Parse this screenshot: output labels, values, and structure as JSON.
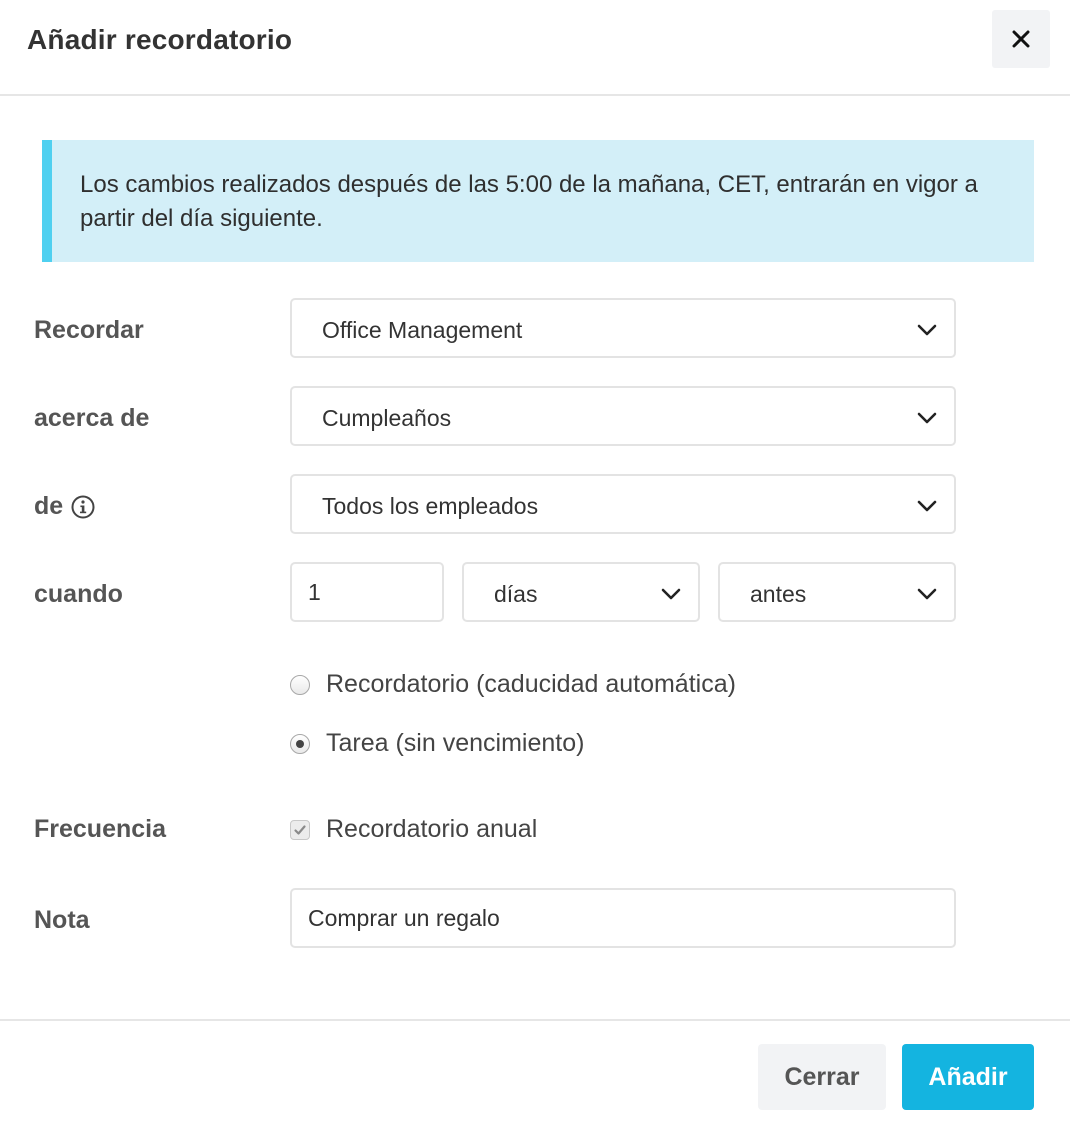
{
  "header": {
    "title": "Añadir recordatorio",
    "close_icon": "close-icon"
  },
  "info": {
    "text": "Los cambios realizados después de las 5:00 de la mañana, CET, entrarán en vigor a partir del día siguiente.",
    "accent": "#4fd0f0",
    "background": "#d3eff8"
  },
  "form": {
    "remind": {
      "label": "Recordar",
      "value": "Office Management"
    },
    "about": {
      "label": "acerca de",
      "value": "Cumpleaños"
    },
    "of": {
      "label": "de",
      "value": "Todos los empleados",
      "icon": "info-icon"
    },
    "when": {
      "label": "cuando",
      "amount": "1",
      "unit": "días",
      "relation": "antes"
    },
    "type_options": [
      {
        "label": "Recordatorio (caducidad automática)",
        "selected": false
      },
      {
        "label": "Tarea (sin vencimiento)",
        "selected": true
      }
    ],
    "frequency": {
      "label": "Frecuencia",
      "checkbox_label": "Recordatorio anual",
      "checked": true
    },
    "note": {
      "label": "Nota",
      "value": "Comprar un regalo"
    }
  },
  "footer": {
    "cancel_label": "Cerrar",
    "submit_label": "Añadir",
    "primary_color": "#14b4e0"
  }
}
